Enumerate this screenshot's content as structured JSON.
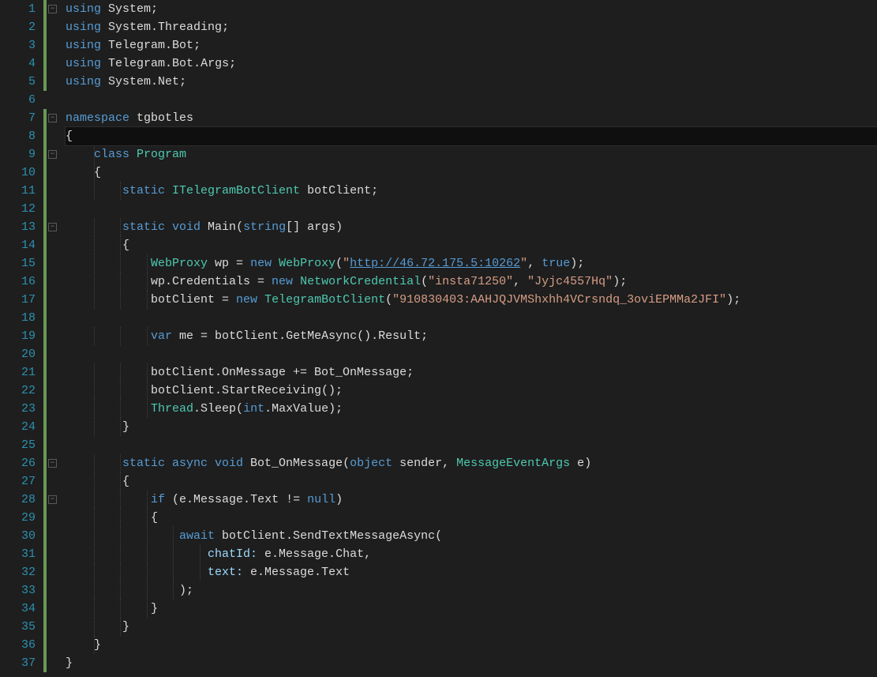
{
  "editor": {
    "lineCount": 37,
    "currentLine": 8,
    "changeBars": [
      {
        "from": 1,
        "to": 5
      },
      {
        "from": 7,
        "to": 37
      }
    ],
    "foldMarks": [
      {
        "line": 1,
        "glyph": "-"
      },
      {
        "line": 7,
        "glyph": "-"
      },
      {
        "line": 9,
        "glyph": "-"
      },
      {
        "line": 13,
        "glyph": "-"
      },
      {
        "line": 26,
        "glyph": "-"
      },
      {
        "line": 28,
        "glyph": "-"
      }
    ],
    "lines": {
      "1": [
        {
          "t": "using ",
          "c": "kw"
        },
        {
          "t": "System",
          "c": "ident"
        },
        {
          "t": ";",
          "c": "pun"
        }
      ],
      "2": [
        {
          "t": "using ",
          "c": "kw"
        },
        {
          "t": "System",
          "c": "ident"
        },
        {
          "t": ".",
          "c": "pun"
        },
        {
          "t": "Threading",
          "c": "ident"
        },
        {
          "t": ";",
          "c": "pun"
        }
      ],
      "3": [
        {
          "t": "using ",
          "c": "kw"
        },
        {
          "t": "Telegram",
          "c": "ident"
        },
        {
          "t": ".",
          "c": "pun"
        },
        {
          "t": "Bot",
          "c": "ident"
        },
        {
          "t": ";",
          "c": "pun"
        }
      ],
      "4": [
        {
          "t": "using ",
          "c": "kw"
        },
        {
          "t": "Telegram",
          "c": "ident"
        },
        {
          "t": ".",
          "c": "pun"
        },
        {
          "t": "Bot",
          "c": "ident"
        },
        {
          "t": ".",
          "c": "pun"
        },
        {
          "t": "Args",
          "c": "ident"
        },
        {
          "t": ";",
          "c": "pun"
        }
      ],
      "5": [
        {
          "t": "using ",
          "c": "kw"
        },
        {
          "t": "System",
          "c": "ident"
        },
        {
          "t": ".",
          "c": "pun"
        },
        {
          "t": "Net",
          "c": "ident"
        },
        {
          "t": ";",
          "c": "pun"
        }
      ],
      "6": [],
      "7": [
        {
          "t": "namespace ",
          "c": "kw"
        },
        {
          "t": "tgbotles",
          "c": "ident"
        }
      ],
      "8": [
        {
          "t": "{",
          "c": "pun"
        }
      ],
      "9": [
        {
          "t": "    ",
          "c": "pun"
        },
        {
          "t": "class ",
          "c": "kw"
        },
        {
          "t": "Program",
          "c": "type"
        }
      ],
      "10": [
        {
          "t": "    {",
          "c": "pun"
        }
      ],
      "11": [
        {
          "t": "        ",
          "c": "pun"
        },
        {
          "t": "static ",
          "c": "kw"
        },
        {
          "t": "ITelegramBotClient",
          "c": "type"
        },
        {
          "t": " botClient;",
          "c": "ident"
        }
      ],
      "12": [],
      "13": [
        {
          "t": "        ",
          "c": "pun"
        },
        {
          "t": "static void ",
          "c": "kw"
        },
        {
          "t": "Main",
          "c": "ident"
        },
        {
          "t": "(",
          "c": "pun"
        },
        {
          "t": "string",
          "c": "kw"
        },
        {
          "t": "[] ",
          "c": "pun"
        },
        {
          "t": "args",
          "c": "ident"
        },
        {
          "t": ")",
          "c": "pun"
        }
      ],
      "14": [
        {
          "t": "        {",
          "c": "pun"
        }
      ],
      "15": [
        {
          "t": "            ",
          "c": "pun"
        },
        {
          "t": "WebProxy",
          "c": "type"
        },
        {
          "t": " wp = ",
          "c": "ident"
        },
        {
          "t": "new ",
          "c": "kw"
        },
        {
          "t": "WebProxy",
          "c": "type"
        },
        {
          "t": "(",
          "c": "pun"
        },
        {
          "t": "\"",
          "c": "str"
        },
        {
          "t": "http://46.72.175.5:10262",
          "c": "url"
        },
        {
          "t": "\"",
          "c": "str"
        },
        {
          "t": ", ",
          "c": "pun"
        },
        {
          "t": "true",
          "c": "kw"
        },
        {
          "t": ");",
          "c": "pun"
        }
      ],
      "16": [
        {
          "t": "            wp.Credentials = ",
          "c": "ident"
        },
        {
          "t": "new ",
          "c": "kw"
        },
        {
          "t": "NetworkCredential",
          "c": "type"
        },
        {
          "t": "(",
          "c": "pun"
        },
        {
          "t": "\"insta71250\"",
          "c": "str"
        },
        {
          "t": ", ",
          "c": "pun"
        },
        {
          "t": "\"Jyjc4557Hq\"",
          "c": "str"
        },
        {
          "t": ");",
          "c": "pun"
        }
      ],
      "17": [
        {
          "t": "            botClient = ",
          "c": "ident"
        },
        {
          "t": "new ",
          "c": "kw"
        },
        {
          "t": "TelegramBotClient",
          "c": "type"
        },
        {
          "t": "(",
          "c": "pun"
        },
        {
          "t": "\"910830403:AAHJQJVMShxhh4VCrsndq_3oviEPMMa2JFI\"",
          "c": "str"
        },
        {
          "t": ");",
          "c": "pun"
        }
      ],
      "18": [],
      "19": [
        {
          "t": "            ",
          "c": "pun"
        },
        {
          "t": "var ",
          "c": "kw"
        },
        {
          "t": "me = botClient.GetMeAsync().Result;",
          "c": "ident"
        }
      ],
      "20": [],
      "21": [
        {
          "t": "            botClient.OnMessage += Bot_OnMessage;",
          "c": "ident"
        }
      ],
      "22": [
        {
          "t": "            botClient.StartReceiving();",
          "c": "ident"
        }
      ],
      "23": [
        {
          "t": "            ",
          "c": "pun"
        },
        {
          "t": "Thread",
          "c": "type"
        },
        {
          "t": ".Sleep(",
          "c": "ident"
        },
        {
          "t": "int",
          "c": "kw"
        },
        {
          "t": ".MaxValue);",
          "c": "ident"
        }
      ],
      "24": [
        {
          "t": "        }",
          "c": "pun"
        }
      ],
      "25": [],
      "26": [
        {
          "t": "        ",
          "c": "pun"
        },
        {
          "t": "static async void ",
          "c": "kw"
        },
        {
          "t": "Bot_OnMessage",
          "c": "ident"
        },
        {
          "t": "(",
          "c": "pun"
        },
        {
          "t": "object ",
          "c": "kw"
        },
        {
          "t": "sender",
          "c": "ident"
        },
        {
          "t": ", ",
          "c": "pun"
        },
        {
          "t": "MessageEventArgs",
          "c": "type"
        },
        {
          "t": " e",
          "c": "ident"
        },
        {
          "t": ")",
          "c": "pun"
        }
      ],
      "27": [
        {
          "t": "        {",
          "c": "pun"
        }
      ],
      "28": [
        {
          "t": "            ",
          "c": "pun"
        },
        {
          "t": "if ",
          "c": "kw"
        },
        {
          "t": "(e.Message.Text != ",
          "c": "ident"
        },
        {
          "t": "null",
          "c": "kw"
        },
        {
          "t": ")",
          "c": "pun"
        }
      ],
      "29": [
        {
          "t": "            {",
          "c": "pun"
        }
      ],
      "30": [
        {
          "t": "                ",
          "c": "pun"
        },
        {
          "t": "await ",
          "c": "kw"
        },
        {
          "t": "botClient.SendTextMessageAsync(",
          "c": "ident"
        }
      ],
      "31": [
        {
          "t": "                    ",
          "c": "pun"
        },
        {
          "t": "chatId:",
          "c": "named"
        },
        {
          "t": " e.Message.Chat,",
          "c": "ident"
        }
      ],
      "32": [
        {
          "t": "                    ",
          "c": "pun"
        },
        {
          "t": "text:",
          "c": "named"
        },
        {
          "t": " e.Message.Text",
          "c": "ident"
        }
      ],
      "33": [
        {
          "t": "                );",
          "c": "pun"
        }
      ],
      "34": [
        {
          "t": "            }",
          "c": "pun"
        }
      ],
      "35": [
        {
          "t": "        }",
          "c": "pun"
        }
      ],
      "36": [
        {
          "t": "    }",
          "c": "pun"
        }
      ],
      "37": [
        {
          "t": "}",
          "c": "pun"
        }
      ]
    }
  }
}
